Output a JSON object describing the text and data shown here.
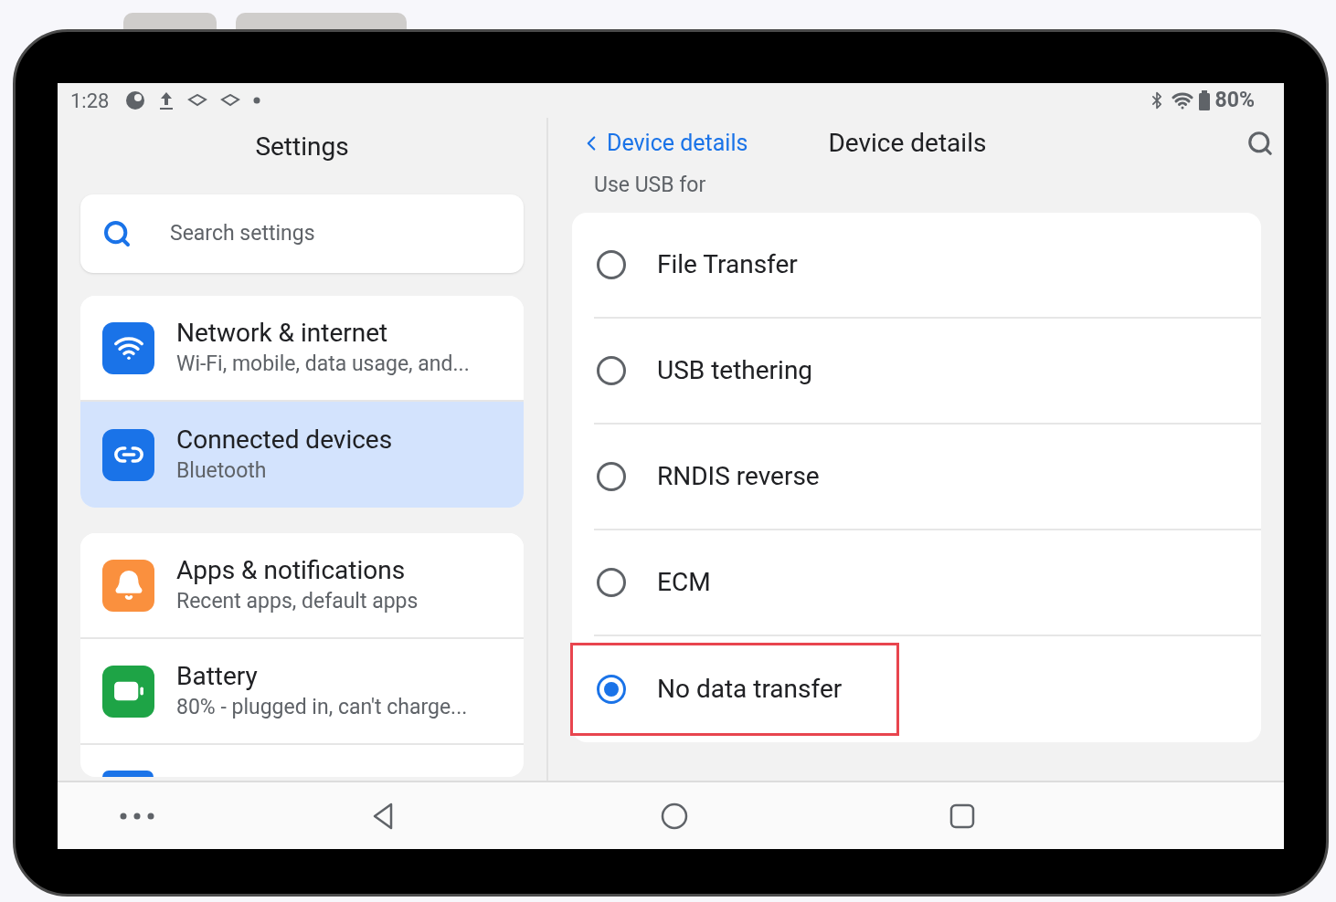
{
  "status_bar": {
    "time": "1:28",
    "battery": "80%"
  },
  "settings": {
    "title": "Settings",
    "search": {
      "placeholder": "Search settings"
    },
    "groups": [
      {
        "items": [
          {
            "kind": "wifi",
            "color": "#1a73e8",
            "title": "Network & internet",
            "subtitle": "Wi-Fi, mobile, data usage, and...",
            "selected": false
          },
          {
            "kind": "link",
            "color": "#1a73e8",
            "title": "Connected devices",
            "subtitle": "Bluetooth",
            "selected": true
          }
        ]
      },
      {
        "items": [
          {
            "kind": "bell",
            "color": "#fa903e",
            "title": "Apps & notifications",
            "subtitle": "Recent apps, default apps",
            "selected": false
          },
          {
            "kind": "battery",
            "color": "#1ea446",
            "title": "Battery",
            "subtitle": "80% - plugged in, can't charge...",
            "selected": false
          },
          {
            "kind": "cut",
            "color": "#1a73e8"
          }
        ]
      }
    ]
  },
  "detail": {
    "back_link": "Device details",
    "title": "Device details",
    "section": "Use USB for",
    "options": [
      {
        "label": "File Transfer",
        "selected": false,
        "highlighted": false
      },
      {
        "label": "USB tethering",
        "selected": false,
        "highlighted": false
      },
      {
        "label": "RNDIS reverse",
        "selected": false,
        "highlighted": false
      },
      {
        "label": "ECM",
        "selected": false,
        "highlighted": false
      },
      {
        "label": "No data transfer",
        "selected": true,
        "highlighted": true
      }
    ]
  }
}
